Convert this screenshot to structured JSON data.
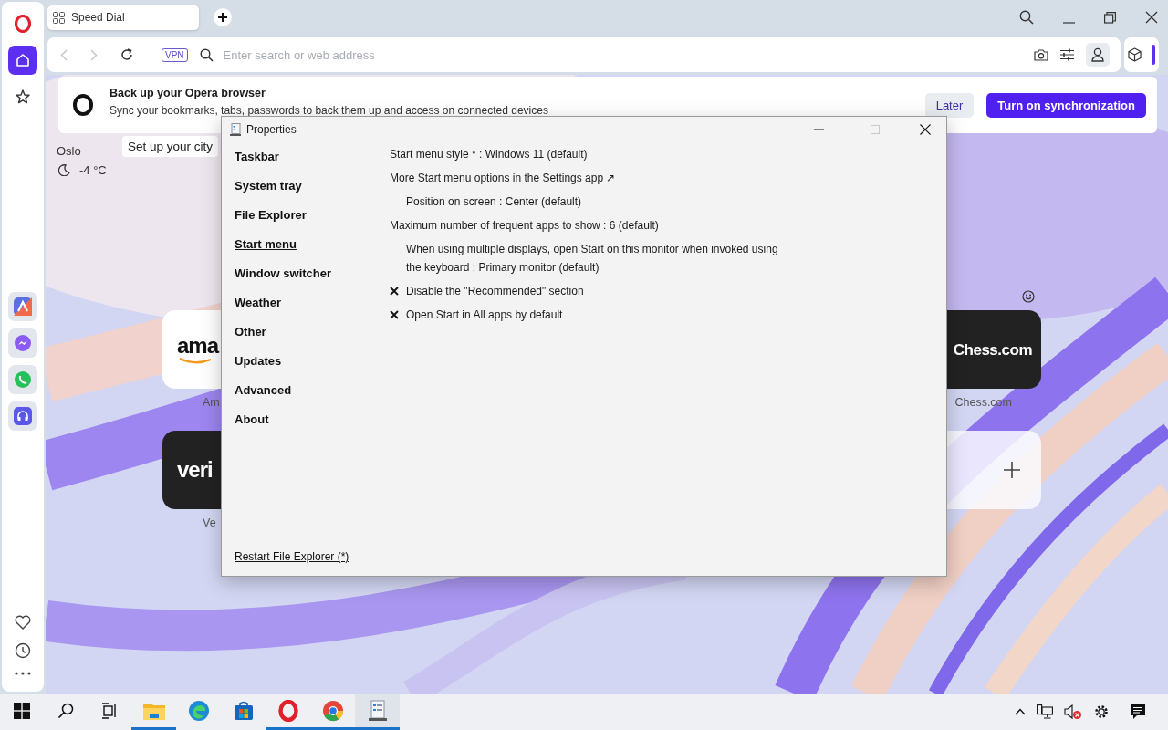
{
  "sidebar": {
    "top_items": [
      {
        "kind": "home",
        "selected": true
      },
      {
        "kind": "star",
        "selected": false
      }
    ],
    "apps": [
      {
        "kind": "aria"
      },
      {
        "kind": "messenger"
      },
      {
        "kind": "whatsapp"
      },
      {
        "kind": "music"
      }
    ],
    "bottom_items": [
      {
        "kind": "heart"
      },
      {
        "kind": "clock"
      },
      {
        "kind": "more"
      }
    ]
  },
  "tabs": [
    {
      "label": "Speed Dial",
      "selected": true
    }
  ],
  "address_bar": {
    "vpn_badge": "VPN",
    "placeholder": "Enter search or web address"
  },
  "sync_banner": {
    "title": "Back up your Opera browser",
    "text": "Sync your bookmarks, tabs, passwords to back them up and access on connected devices",
    "buttons": [
      {
        "label": "Later",
        "kind": "secondary"
      },
      {
        "label": "Turn on synchronization",
        "kind": "primary"
      }
    ]
  },
  "weather": {
    "city": "Oslo",
    "temperature": "-4 °C",
    "tooltip": "Set up your city"
  },
  "speed_dial": {
    "rows": [
      [
        {
          "kind": "site",
          "logo": "ama",
          "label": "Am",
          "dark": false
        },
        {
          "kind": "site",
          "logo": "Chess.com",
          "label": "Chess.com",
          "dark": true
        }
      ],
      [
        {
          "kind": "site",
          "logo": "veri",
          "label": "Ve",
          "dark": true
        },
        {
          "kind": "add"
        }
      ]
    ]
  },
  "dialog": {
    "title": "Properties",
    "nav": [
      {
        "label": "Taskbar",
        "selected": false
      },
      {
        "label": "System tray",
        "selected": false
      },
      {
        "label": "File Explorer",
        "selected": false
      },
      {
        "label": "Start menu",
        "selected": true
      },
      {
        "label": "Window switcher",
        "selected": false
      },
      {
        "label": "Weather",
        "selected": false
      },
      {
        "label": "Other",
        "selected": false
      },
      {
        "label": "Updates",
        "selected": false
      },
      {
        "label": "Advanced",
        "selected": false
      },
      {
        "label": "About",
        "selected": false
      }
    ],
    "settings": [
      {
        "kind": "value",
        "text": "Start menu style * : Windows 11 (default)",
        "indented": false
      },
      {
        "kind": "link",
        "text": "More Start menu options in the Settings app ↗"
      },
      {
        "kind": "value",
        "text": "Position on screen : Center (default)",
        "indented": true
      },
      {
        "kind": "value",
        "text": "Maximum number of frequent apps to show : 6 (default)",
        "indented": false
      },
      {
        "kind": "value",
        "text": "When using multiple displays, open Start on this monitor when invoked using the keyboard : Primary monitor (default)",
        "indented": true
      },
      {
        "kind": "checkbox",
        "text": "Disable the \"Recommended\" section",
        "checked": true
      },
      {
        "kind": "checkbox",
        "text": "Open Start in All apps by default",
        "checked": true
      }
    ],
    "footer_link": "Restart File Explorer (*)"
  },
  "taskbar": {
    "apps": [
      {
        "kind": "explorer",
        "running": true,
        "selected": false
      },
      {
        "kind": "edge",
        "running": false,
        "selected": false
      },
      {
        "kind": "store",
        "running": false,
        "selected": false
      },
      {
        "kind": "opera",
        "running": true,
        "selected": false
      },
      {
        "kind": "chrome",
        "running": true,
        "selected": false
      },
      {
        "kind": "properties",
        "running": true,
        "selected": true
      }
    ]
  }
}
